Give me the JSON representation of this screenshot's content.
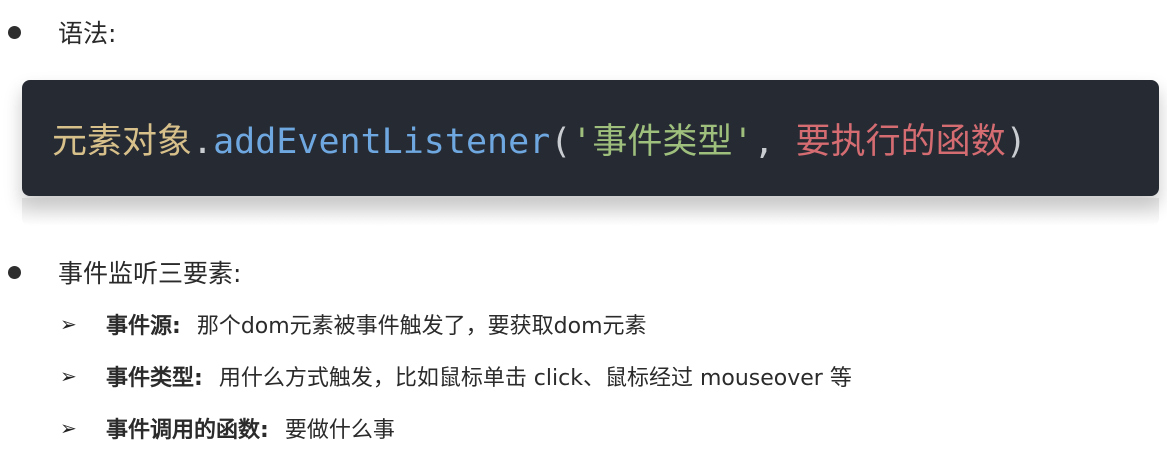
{
  "syntax_bullet": {
    "label": "语法:"
  },
  "code": {
    "element_object": "元素对象",
    "dot": ".",
    "method": "addEventListener",
    "open_paren": "(",
    "event_type_string": "'事件类型'",
    "comma": ",",
    "callback": "要执行的函数",
    "close_paren": ")",
    "colors": {
      "background": "#262b33",
      "object": "#d8c08b",
      "method": "#6fa8e0",
      "string": "#9fc07d",
      "param": "#d46c72"
    }
  },
  "three_elements_bullet": {
    "label": "事件监听三要素:"
  },
  "items": [
    {
      "arrow": "➢",
      "term": "事件源:",
      "desc": "那个dom元素被事件触发了，要获取dom元素"
    },
    {
      "arrow": "➢",
      "term": "事件类型:",
      "desc": "用什么方式触发，比如鼠标单击 click、鼠标经过 mouseover 等"
    },
    {
      "arrow": "➢",
      "term": "事件调用的函数:",
      "desc": "要做什么事"
    }
  ]
}
